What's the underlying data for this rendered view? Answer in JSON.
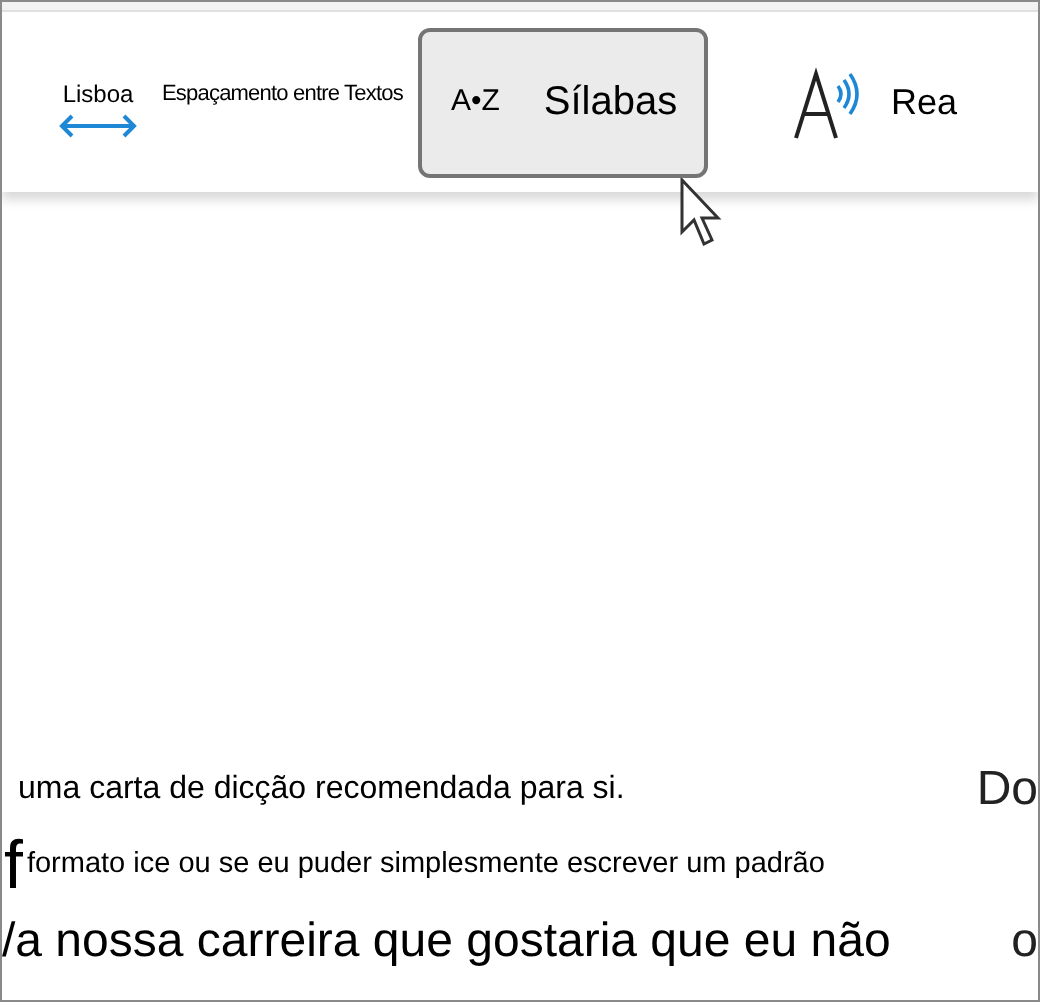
{
  "ribbon": {
    "items": [
      {
        "kind": "spacing",
        "label": "Lisboa"
      },
      {
        "kind": "text",
        "label": "Espaçamento entre Textos"
      },
      {
        "kind": "button",
        "icon_text": "A•Z",
        "label": "Sílabas",
        "hovered": true
      },
      {
        "kind": "read-aloud",
        "label": "Rea"
      }
    ]
  },
  "document": {
    "lines": [
      {
        "text": "uma carta de dicção recomendada para si.",
        "edge": "Do"
      },
      {
        "lead": "f",
        "text": "formato ice ou se eu puder simplesmente escrever um padrão"
      },
      {
        "text": "/a nossa carreira que gostaria que eu não",
        "edge": "o"
      }
    ]
  }
}
